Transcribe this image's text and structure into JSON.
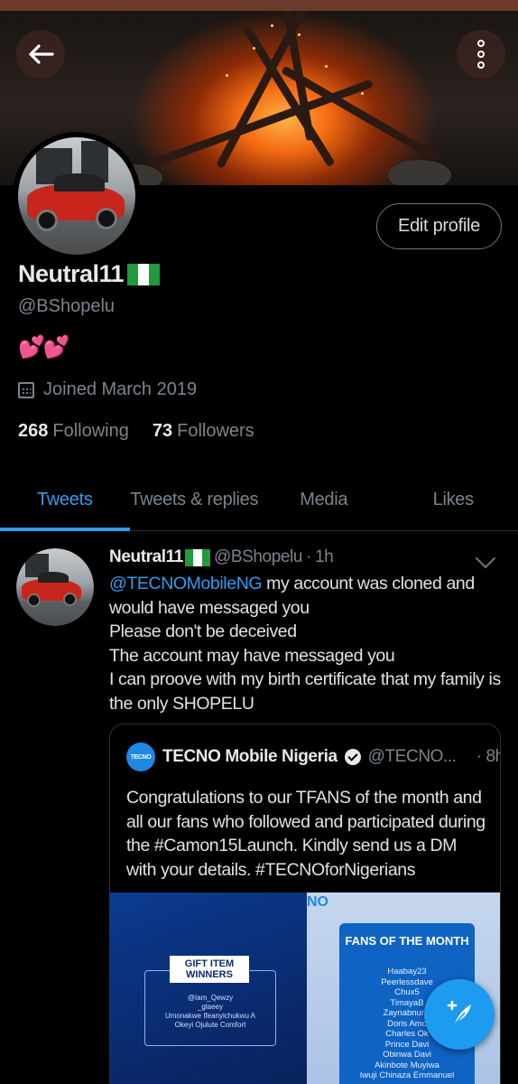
{
  "profile": {
    "display_name": "Neutral11",
    "handle": "@BShopelu",
    "bio": "💕💕",
    "joined": "Joined March 2019",
    "following_count": "268",
    "following_label": "Following",
    "followers_count": "73",
    "followers_label": "Followers",
    "edit_profile_label": "Edit profile"
  },
  "tabs": [
    {
      "label": "Tweets",
      "active": true
    },
    {
      "label": "Tweets & replies",
      "active": false
    },
    {
      "label": "Media",
      "active": false
    },
    {
      "label": "Likes",
      "active": false
    }
  ],
  "tweet": {
    "name": "Neutral11",
    "handle": "@BShopelu",
    "time": "1h",
    "mention": "@TECNOMobileNG",
    "text_after_mention": " my account was cloned and would have messaged you",
    "line2": "Please don't be deceived",
    "line3": "The account may have messaged you",
    "line4": "I can proove with my birth certificate that my family is the only SHOPELU"
  },
  "quoted": {
    "logo_text": "TECNO",
    "name": "TECNO Mobile Nigeria",
    "handle": "@TECNO...",
    "time": "· 8h",
    "text": "Congratulations to our TFANS of the month and all our fans who followed and participated during the #Camon15Launch. Kindly send us a DM with your details. #TECNOforNigerians",
    "image": {
      "gift_title": "GIFT ITEM WINNERS",
      "gift_names": [
        "@Iam_Qewzy",
        "_glaeey",
        "Umonakwe Ifeanyichukwu A",
        "Okeyi Ojulute Comfort"
      ],
      "brand_mark": "NO",
      "fans_title": "FANS OF THE MONTH",
      "fans_names": [
        "Haabay23",
        "Peerlessdave",
        "Chux5",
        "TimayaB",
        "Zaynabnunu",
        "Doris Amo",
        "Charles Ok",
        "Prince Davi",
        "Obinwa Davi",
        "Akinbote Muyiwa",
        "Iwuji Chinaza Emmanuel"
      ]
    }
  },
  "icons": {
    "back": "back-arrow-icon",
    "more": "more-vertical-icon",
    "calendar": "calendar-icon",
    "verified": "verified-badge-icon",
    "compose": "compose-tweet-icon",
    "chevron": "chevron-down-icon"
  },
  "colors": {
    "accent": "#1d9bf0",
    "background": "#000000",
    "muted_text": "#7b848c",
    "heart": "#e5336d",
    "flag_green": "#1f9a3c"
  }
}
